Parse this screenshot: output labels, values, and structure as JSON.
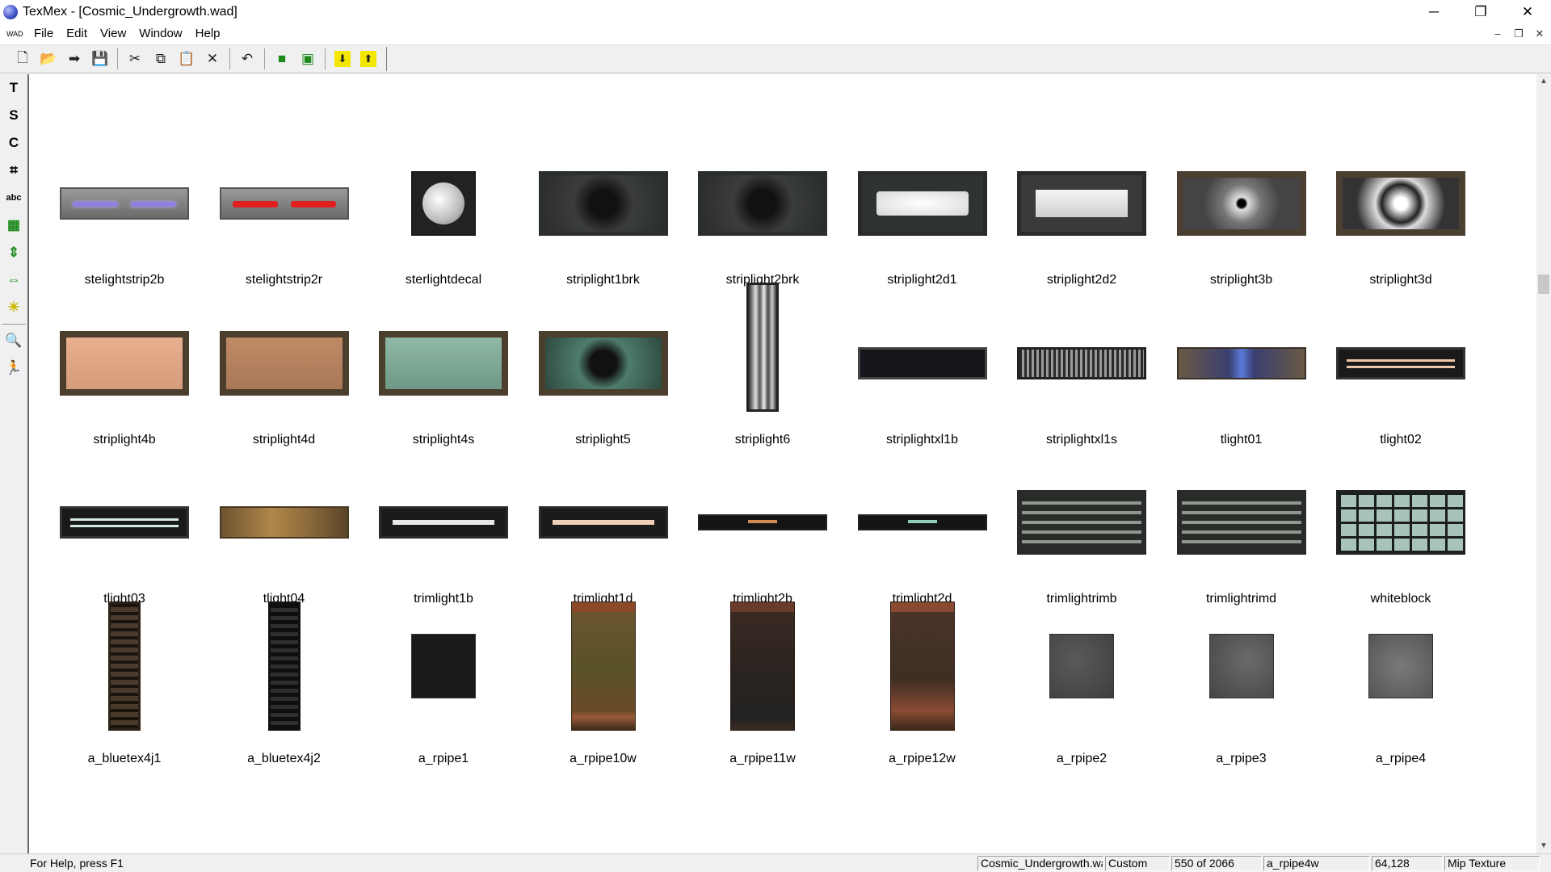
{
  "window": {
    "title": "TexMex - [Cosmic_Undergrowth.wad]",
    "minimize": "─",
    "restore": "❐",
    "close": "✕"
  },
  "menu": {
    "doc_icon": "WAD",
    "items": [
      "File",
      "Edit",
      "View",
      "Window",
      "Help"
    ],
    "mdi_minimize": "–",
    "mdi_restore": "❐",
    "mdi_close": "✕"
  },
  "toolbar": {
    "buttons": [
      {
        "name": "new-file-icon",
        "glyph": "🗋"
      },
      {
        "name": "open-folder-icon",
        "glyph": "📂"
      },
      {
        "name": "arrow-right-icon",
        "glyph": "➡"
      },
      {
        "name": "save-disk-icon",
        "glyph": "💾"
      },
      {
        "name": "cut-scissors-icon",
        "glyph": "✂"
      },
      {
        "name": "copy-icon",
        "glyph": "⧉"
      },
      {
        "name": "paste-clipboard-icon",
        "glyph": "📋"
      },
      {
        "name": "delete-x-icon",
        "glyph": "✕"
      },
      {
        "name": "undo-icon",
        "glyph": "↶"
      },
      {
        "name": "green-square-icon",
        "glyph": "■"
      },
      {
        "name": "fit-frame-icon",
        "glyph": "▣"
      },
      {
        "name": "import-down-arrow-icon",
        "glyph": "⬇"
      },
      {
        "name": "export-up-arrow-icon",
        "glyph": "⬆"
      }
    ]
  },
  "side_toolbar": {
    "buttons": [
      {
        "name": "text-tool-icon",
        "glyph": "T"
      },
      {
        "name": "s-tool-icon",
        "glyph": "S"
      },
      {
        "name": "c-tool-icon",
        "glyph": "C"
      },
      {
        "name": "crop-icon",
        "glyph": "⌗"
      },
      {
        "name": "abc-text-icon",
        "glyph": "abc"
      },
      {
        "name": "layers-icon",
        "glyph": "▦"
      },
      {
        "name": "flip-vertical-icon",
        "glyph": "⇕"
      },
      {
        "name": "flip-horizontal-icon",
        "glyph": "⇔"
      },
      {
        "name": "brightness-sun-icon",
        "glyph": "☀"
      },
      {
        "name": "zoom-magnifier-icon",
        "glyph": "🔍"
      },
      {
        "name": "run-figure-icon",
        "glyph": "🏃"
      }
    ]
  },
  "textures": [
    {
      "label": "stelightstrip2b",
      "kind": "strip-blue"
    },
    {
      "label": "stelightstrip2r",
      "kind": "strip-red"
    },
    {
      "label": "sterlightdecal",
      "kind": "decal"
    },
    {
      "label": "striplight1brk",
      "kind": "broken-dark"
    },
    {
      "label": "striplight2brk",
      "kind": "broken-dark2"
    },
    {
      "label": "striplight2d1",
      "kind": "lit-white"
    },
    {
      "label": "striplight2d2",
      "kind": "lit-white2"
    },
    {
      "label": "striplight3b",
      "kind": "cracked"
    },
    {
      "label": "striplight3d",
      "kind": "shattered"
    },
    {
      "label": "striplight4b",
      "kind": "panel-peach"
    },
    {
      "label": "striplight4d",
      "kind": "panel-tan"
    },
    {
      "label": "striplight4s",
      "kind": "panel-green"
    },
    {
      "label": "striplight5",
      "kind": "panel-broken-green"
    },
    {
      "label": "striplight6",
      "kind": "vertical-tube"
    },
    {
      "label": "striplightxl1b",
      "kind": "dark-bar"
    },
    {
      "label": "striplightxl1s",
      "kind": "ribbed-bar"
    },
    {
      "label": "tlight01",
      "kind": "rusty-blue"
    },
    {
      "label": "tlight02",
      "kind": "tube-pair"
    },
    {
      "label": "tlight03",
      "kind": "tube-pair-green"
    },
    {
      "label": "tlight04",
      "kind": "rusty-orange"
    },
    {
      "label": "trimlight1b",
      "kind": "trim-white"
    },
    {
      "label": "trimlight1d",
      "kind": "trim-peach"
    },
    {
      "label": "trimlight2b",
      "kind": "thin-trim-orange"
    },
    {
      "label": "trimlight2d",
      "kind": "thin-trim-green"
    },
    {
      "label": "trimlightrimb",
      "kind": "rim-grey"
    },
    {
      "label": "trimlightrimd",
      "kind": "rim-grey2"
    },
    {
      "label": "whiteblock",
      "kind": "grid-block"
    },
    {
      "label": "a_bluetex4j1",
      "kind": "vent-brown"
    },
    {
      "label": "a_bluetex4j2",
      "kind": "vent-black"
    },
    {
      "label": "a_rpipe1",
      "kind": "square-black"
    },
    {
      "label": "a_rpipe10w",
      "kind": "pipe-olive"
    },
    {
      "label": "a_rpipe11w",
      "kind": "pipe-dark"
    },
    {
      "label": "a_rpipe12w",
      "kind": "pipe-rust"
    },
    {
      "label": "a_rpipe2",
      "kind": "square-grey"
    },
    {
      "label": "a_rpipe3",
      "kind": "square-grey2"
    },
    {
      "label": "a_rpipe4",
      "kind": "square-grey3"
    }
  ],
  "status": {
    "help": "For Help, press F1",
    "file": "Cosmic_Undergrowth.wad",
    "palette": "Custom",
    "position": "550 of 2066",
    "texture_name": "a_rpipe4w",
    "dimensions": "64,128",
    "type": "Mip Texture"
  }
}
